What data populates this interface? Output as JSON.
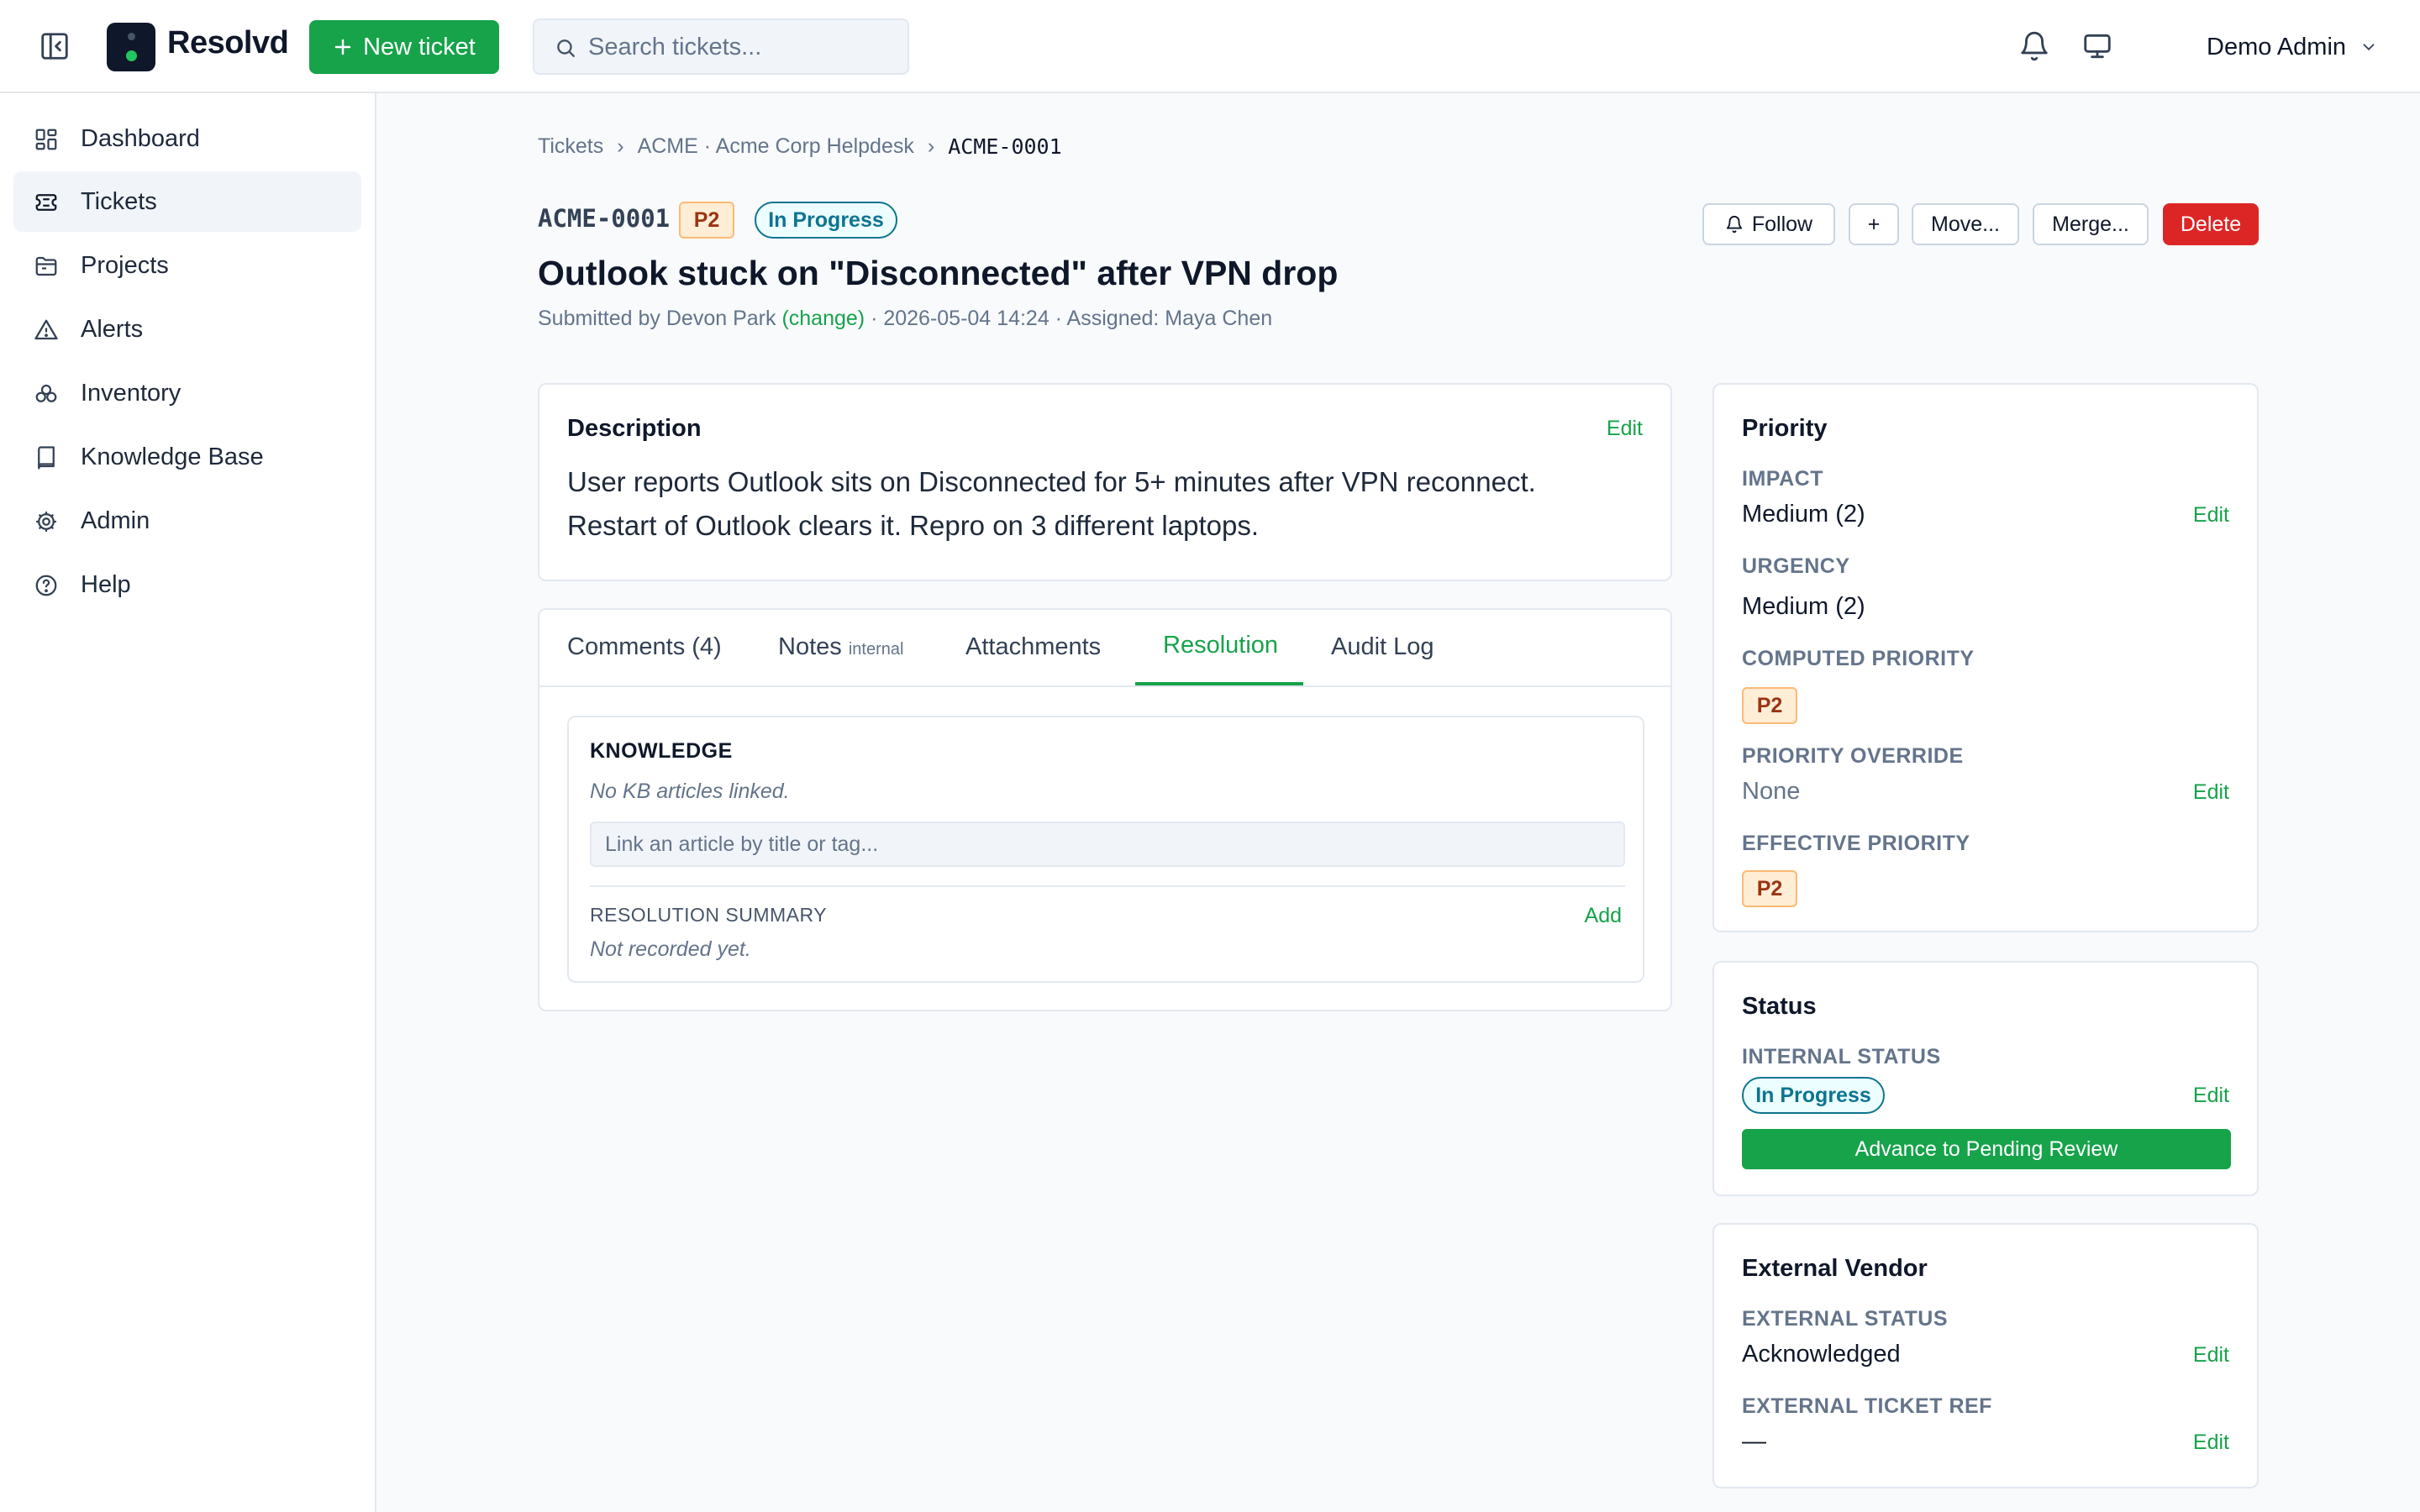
{
  "app": {
    "brand": "Resolvd",
    "new_ticket_label": "New ticket",
    "search_placeholder": "Search tickets...",
    "user_name": "Demo Admin"
  },
  "sidebar": {
    "items": [
      {
        "label": "Dashboard",
        "icon": "dashboard-icon"
      },
      {
        "label": "Tickets",
        "icon": "ticket-icon",
        "active": true
      },
      {
        "label": "Projects",
        "icon": "folder-icon"
      },
      {
        "label": "Alerts",
        "icon": "alert-triangle-icon"
      },
      {
        "label": "Inventory",
        "icon": "inventory-icon"
      },
      {
        "label": "Knowledge Base",
        "icon": "book-icon"
      },
      {
        "label": "Admin",
        "icon": "gear-icon"
      },
      {
        "label": "Help",
        "icon": "help-circle-icon"
      }
    ]
  },
  "breadcrumb": {
    "items": [
      "Tickets",
      "ACME · Acme Corp Helpdesk",
      "ACME-0001"
    ],
    "separator": "›"
  },
  "ticket": {
    "id": "ACME-0001",
    "priority": "P2",
    "status": "In Progress",
    "title": "Outlook stuck on \"Disconnected\" after VPN drop",
    "submitted_prefix": "Submitted by Devon Park",
    "change_link": "(change)",
    "submitted_suffix": "· 2026-05-04 14:24 · Assigned: Maya Chen"
  },
  "actions": {
    "follow": "Follow",
    "plus": "+",
    "move": "Move...",
    "merge": "Merge...",
    "delete": "Delete"
  },
  "description": {
    "title": "Description",
    "edit": "Edit",
    "body": "User reports Outlook sits on Disconnected for 5+ minutes after VPN reconnect. Restart of Outlook clears it. Repro on 3 different laptops."
  },
  "tabs": {
    "comments": "Comments (4)",
    "notes": "Notes",
    "notes_tag": "internal",
    "attachments": "Attachments",
    "resolution": "Resolution",
    "audit": "Audit Log",
    "active": "Resolution"
  },
  "resolution": {
    "knowledge_title": "KNOWLEDGE",
    "no_articles": "No KB articles linked.",
    "link_placeholder": "Link an article by title or tag...",
    "summary_title": "RESOLUTION SUMMARY",
    "summary_add": "Add",
    "summary_empty": "Not recorded yet."
  },
  "priority_panel": {
    "title": "Priority",
    "impact_label": "IMPACT",
    "impact_value": "Medium (2)",
    "urgency_label": "URGENCY",
    "urgency_value": "Medium (2)",
    "computed_label": "COMPUTED PRIORITY",
    "computed_value": "P2",
    "override_label": "PRIORITY OVERRIDE",
    "override_value": "None",
    "effective_label": "EFFECTIVE PRIORITY",
    "effective_value": "P2",
    "edit": "Edit"
  },
  "status_panel": {
    "title": "Status",
    "internal_label": "INTERNAL STATUS",
    "internal_value": "In Progress",
    "edit": "Edit",
    "advance_button": "Advance to Pending Review"
  },
  "vendor_panel": {
    "title": "External Vendor",
    "status_label": "EXTERNAL STATUS",
    "status_value": "Acknowledged",
    "ref_label": "EXTERNAL TICKET REF",
    "ref_value": "—",
    "edit": "Edit"
  },
  "colors": {
    "accent": "#16a34a",
    "danger": "#dc2626",
    "status": "#0e7490",
    "priority_bg": "#ffedd5",
    "priority_text": "#9a3412"
  }
}
